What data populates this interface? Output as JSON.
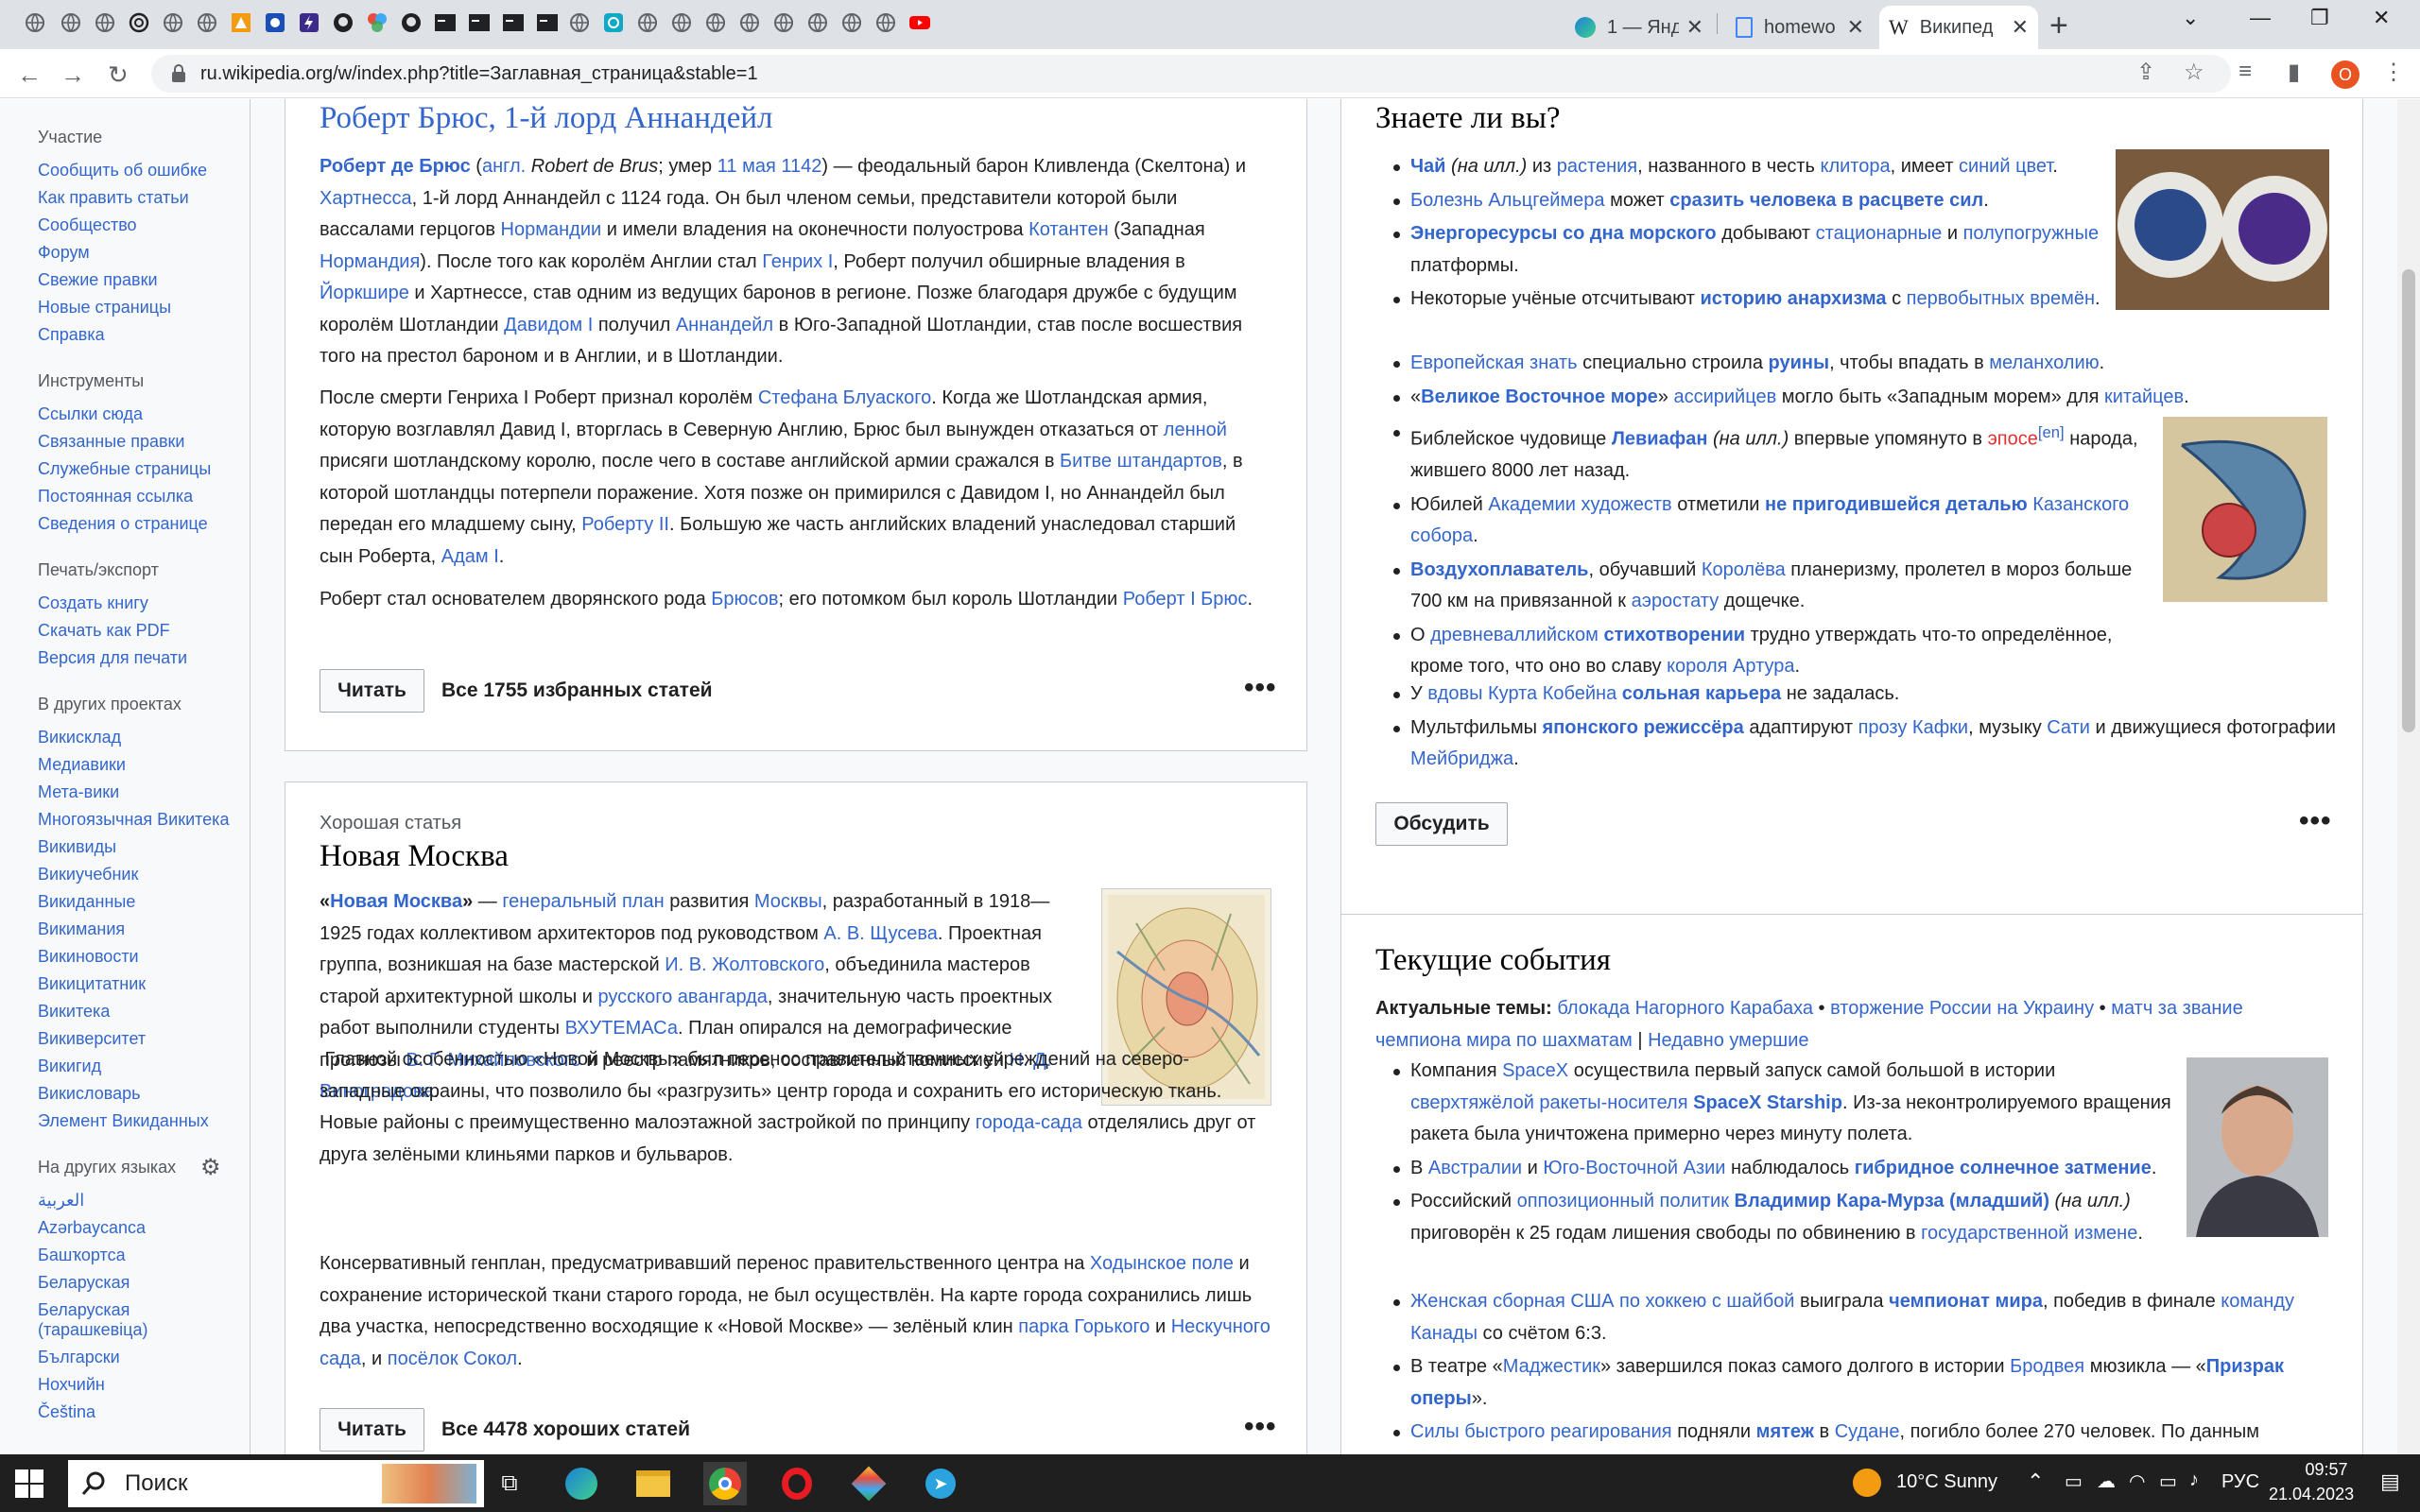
{
  "browser": {
    "tabs": [
      {
        "title": "1 — Янд",
        "active": false
      },
      {
        "title": "homewo",
        "active": false
      },
      {
        "title": "Википед",
        "active": true
      }
    ],
    "url": "ru.wikipedia.org/w/index.php?title=Заглавная_страница&stable=1",
    "profile_initial": "O"
  },
  "sidebar": {
    "sections": [
      {
        "heading": "Участие",
        "links": [
          "Сообщить об ошибке",
          "Как править статьи",
          "Сообщество",
          "Форум",
          "Свежие правки",
          "Новые страницы",
          "Справка"
        ]
      },
      {
        "heading": "Инструменты",
        "links": [
          "Ссылки сюда",
          "Связанные правки",
          "Служебные страницы",
          "Постоянная ссылка",
          "Сведения о странице"
        ]
      },
      {
        "heading": "Печать/экспорт",
        "links": [
          "Создать книгу",
          "Скачать как PDF",
          "Версия для печати"
        ]
      },
      {
        "heading": "В других проектах",
        "links": [
          "Викисклад",
          "Медиавики",
          "Мета-вики",
          "Многоязычная Викитека",
          "Викивиды",
          "Викиучебник",
          "Викиданные",
          "Викимания",
          "Викиновости",
          "Викицитатник",
          "Викитека",
          "Викиверситет",
          "Викигид",
          "Викисловарь",
          "Элемент Викиданных"
        ]
      },
      {
        "heading": "На других языках",
        "links": [
          "العربية",
          "Azərbaycanca",
          "Башҡортса",
          "Беларуская",
          "Беларуская (тарашкевіца)",
          "Български",
          "Нохчийн",
          "Čeština"
        ]
      }
    ]
  },
  "featured": {
    "title": "Роберт Брюс, 1-й лорд Аннандейл",
    "read_label": "Читать",
    "all_label": "Все 1755 избранных статей",
    "more": "•••"
  },
  "good": {
    "kicker": "Хорошая статья",
    "title": "Новая Москва",
    "read_label": "Читать",
    "all_label": "Все 4478 хороших статей",
    "more": "•••"
  },
  "dyk": {
    "title": "Знаете ли вы?",
    "discuss_label": "Обсудить",
    "more": "•••"
  },
  "news": {
    "title": "Текущие события",
    "topics_label": "Актуальные темы:"
  },
  "taskbar": {
    "search": "Поиск",
    "weather": "10°C  Sunny",
    "lang": "РУС",
    "time": "09:57",
    "date": "21.04.2023"
  }
}
